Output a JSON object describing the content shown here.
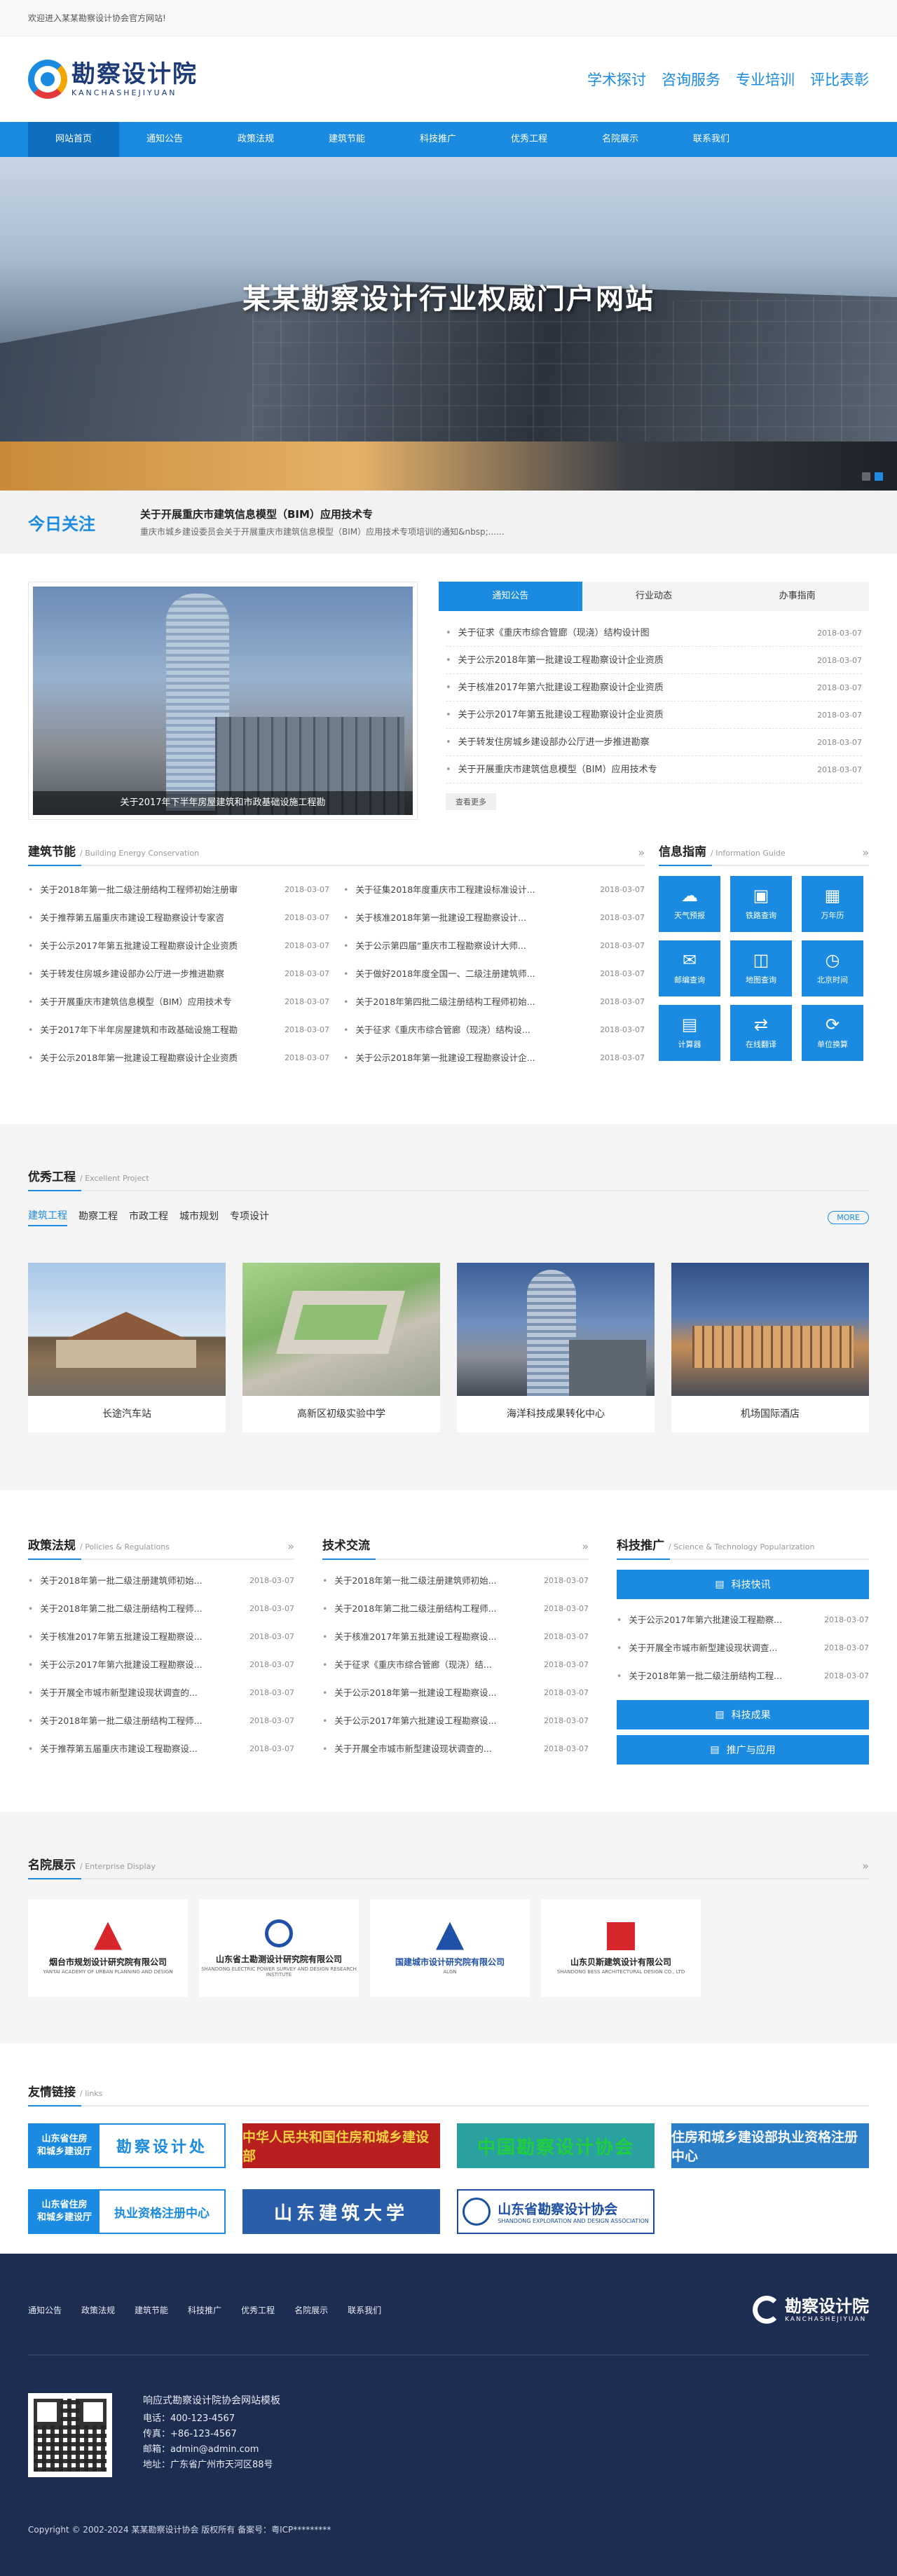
{
  "topbar": {
    "welcome": "欢迎进入某某勘察设计协会官方网站!"
  },
  "header": {
    "logo_cn": "勘察设计院",
    "logo_en": "KANCHASHEJIYUAN",
    "slogans": [
      "学术探讨",
      "咨询服务",
      "专业培训",
      "评比表彰"
    ]
  },
  "nav": {
    "items": [
      "网站首页",
      "通知公告",
      "政策法规",
      "建筑节能",
      "科技推广",
      "优秀工程",
      "名院展示",
      "联系我们"
    ]
  },
  "banner": {
    "title": "某某勘察设计行业权威门户网站"
  },
  "focus": {
    "label": "今日关注",
    "title": "关于开展重庆市建筑信息模型（BIM）应用技术专",
    "desc": "重庆市城乡建设委员会关于开展重庆市建筑信息模型（BIM）应用技术专项培训的通知&nbsp;......"
  },
  "news": {
    "photo_caption": "关于2017年下半年房屋建筑和市政基础设施工程勘",
    "tabs": [
      "通知公告",
      "行业动态",
      "办事指南"
    ],
    "items": [
      {
        "title": "关于征求《重庆市综合管廊（现浇）结构设计图",
        "date": "2018-03-07"
      },
      {
        "title": "关于公示2018年第一批建设工程勘察设计企业资质",
        "date": "2018-03-07"
      },
      {
        "title": "关于核准2017年第六批建设工程勘察设计企业资质",
        "date": "2018-03-07"
      },
      {
        "title": "关于公示2017年第五批建设工程勘察设计企业资质",
        "date": "2018-03-07"
      },
      {
        "title": "关于转发住房城乡建设部办公厅进一步推进勘察",
        "date": "2018-03-07"
      },
      {
        "title": "关于开展重庆市建筑信息模型（BIM）应用技术专",
        "date": "2018-03-07"
      }
    ],
    "more_label": "查看更多"
  },
  "energy": {
    "title": "建筑节能",
    "subtitle": "/ Building Energy Conservation",
    "left": [
      {
        "title": "关于2018年第一批二级注册结构工程师初始注册审",
        "date": "2018-03-07"
      },
      {
        "title": "关于推荐第五届重庆市建设工程勘察设计专家咨",
        "date": "2018-03-07"
      },
      {
        "title": "关于公示2017年第五批建设工程勘察设计企业资质",
        "date": "2018-03-07"
      },
      {
        "title": "关于转发住房城乡建设部办公厅进一步推进勘察",
        "date": "2018-03-07"
      },
      {
        "title": "关于开展重庆市建筑信息模型（BIM）应用技术专",
        "date": "2018-03-07"
      },
      {
        "title": "关于2017年下半年房屋建筑和市政基础设施工程勘",
        "date": "2018-03-07"
      },
      {
        "title": "关于公示2018年第一批建设工程勘察设计企业资质",
        "date": "2018-03-07"
      }
    ],
    "right": [
      {
        "title": "关于征集2018年度重庆市工程建设标准设计...",
        "date": "2018-03-07"
      },
      {
        "title": "关于核准2018年第一批建设工程勘察设计...",
        "date": "2018-03-07"
      },
      {
        "title": "关于公示第四届“重庆市工程勘察设计大师...",
        "date": "2018-03-07"
      },
      {
        "title": "关于做好2018年度全国一、二级注册建筑师...",
        "date": "2018-03-07"
      },
      {
        "title": "关于2018年第四批二级注册结构工程师初始...",
        "date": "2018-03-07"
      },
      {
        "title": "关于征求《重庆市综合管廊（现浇）结构设...",
        "date": "2018-03-07"
      },
      {
        "title": "关于公示2018年第一批建设工程勘察设计企...",
        "date": "2018-03-07"
      }
    ]
  },
  "info": {
    "title": "信息指南",
    "subtitle": "/ Information Guide",
    "cells": [
      {
        "label": "天气预报",
        "icon": "☁"
      },
      {
        "label": "铁路查询",
        "icon": "▣"
      },
      {
        "label": "万年历",
        "icon": "▦"
      },
      {
        "label": "邮编查询",
        "icon": "✉"
      },
      {
        "label": "地图查询",
        "icon": "◫"
      },
      {
        "label": "北京时间",
        "icon": "◷"
      },
      {
        "label": "计算器",
        "icon": "▤"
      },
      {
        "label": "在线翻译",
        "icon": "⇄"
      },
      {
        "label": "单位换算",
        "icon": "⟳"
      }
    ]
  },
  "projects": {
    "title": "优秀工程",
    "subtitle": "/ Excellent Project",
    "tabs": [
      "建筑工程",
      "勘察工程",
      "市政工程",
      "城市规划",
      "专项设计"
    ],
    "more": "MORE",
    "items": [
      "长途汽车站",
      "高新区初级实验中学",
      "海洋科技成果转化中心",
      "机场国际酒店"
    ]
  },
  "policy": {
    "title": "政策法规",
    "subtitle": "/ Policies & Regulations",
    "items": [
      {
        "title": "关于2018年第一批二级注册建筑师初始...",
        "date": "2018-03-07"
      },
      {
        "title": "关于2018年第二批二级注册结构工程师...",
        "date": "2018-03-07"
      },
      {
        "title": "关于核准2017年第五批建设工程勘察设...",
        "date": "2018-03-07"
      },
      {
        "title": "关于公示2017年第六批建设工程勘察设...",
        "date": "2018-03-07"
      },
      {
        "title": "关于开展全市城市新型建设现状调查的...",
        "date": "2018-03-07"
      },
      {
        "title": "关于2018年第一批二级注册结构工程师...",
        "date": "2018-03-07"
      },
      {
        "title": "关于推荐第五届重庆市建设工程勘察设...",
        "date": "2018-03-07"
      }
    ]
  },
  "tech": {
    "title": "技术交流",
    "items": [
      {
        "title": "关于2018年第一批二级注册建筑师初始...",
        "date": "2018-03-07"
      },
      {
        "title": "关于2018年第二批二级注册结构工程师...",
        "date": "2018-03-07"
      },
      {
        "title": "关于核准2017年第五批建设工程勘察设...",
        "date": "2018-03-07"
      },
      {
        "title": "关于征求《重庆市综合管廊（现浇）结...",
        "date": "2018-03-07"
      },
      {
        "title": "关于公示2018年第一批建设工程勘察设...",
        "date": "2018-03-07"
      },
      {
        "title": "关于公示2017年第六批建设工程勘察设...",
        "date": "2018-03-07"
      },
      {
        "title": "关于开展全市城市新型建设现状调查的...",
        "date": "2018-03-07"
      }
    ]
  },
  "science": {
    "title": "科技推广",
    "subtitle": "/ Science & Technology Popularization",
    "bar1": "科技快讯",
    "items": [
      {
        "title": "关于公示2017年第六批建设工程勘察...",
        "date": "2018-03-07"
      },
      {
        "title": "关于开展全市城市新型建设现状调查...",
        "date": "2018-03-07"
      },
      {
        "title": "关于2018年第一批二级注册结构工程...",
        "date": "2018-03-07"
      }
    ],
    "bar2": "科技成果",
    "bar3": "推广与应用"
  },
  "enterprise": {
    "title": "名院展示",
    "subtitle": "/ Enterprise Display",
    "items": [
      {
        "name": "烟台市规划设计研究院有限公司",
        "sub": "YANTAI ACADEMY OF URBAN PLANNING AND DESIGN",
        "color": "#d8262d"
      },
      {
        "name": "山东省土勘测设计研究院有限公司",
        "sub": "SHANDONG ELECTRIC POWER SURVEY AND DESIGN RESEARCH INSTITUTE",
        "color": "#2051a8"
      },
      {
        "name": "国建城市设计研究院有限公司",
        "sub": "ALGN",
        "color": "#2051a8"
      },
      {
        "name": "山东贝斯建筑设计有限公司",
        "sub": "SHANDONG BESS ARCHITECTURAL DESIGN CO., LTD",
        "color": "#d8262d"
      }
    ]
  },
  "links": {
    "title": "友情链接",
    "subtitle": "/ links",
    "l1_left": "山东省住房\n和城乡建设厅",
    "l1_right": "勘察设计处",
    "l2": "中华人民共和国住房和城乡建设部",
    "l3": "中国勘察设计协会",
    "l4": "住房和城乡建设部执业资格注册中心",
    "l5_left": "山东省住房\n和城乡建设厅",
    "l5_right": "执业资格注册中心",
    "l6": "山东建筑大学",
    "l7_main": "山东省勘察设计协会",
    "l7_sub": "SHANDONG EXPLORATION AND DESIGN ASSOCIATION"
  },
  "footer": {
    "nav": [
      "通知公告",
      "政策法规",
      "建筑节能",
      "科技推广",
      "优秀工程",
      "名院展示",
      "联系我们"
    ],
    "logo_cn": "勘察设计院",
    "logo_en": "KANCHASHEJIYUAN",
    "site_title": "响应式勘察设计院协会网站模板",
    "phone": "电话：400-123-4567",
    "fax": "传真：+86-123-4567",
    "email": "邮箱：admin@admin.com",
    "address": "地址：广东省广州市天河区88号",
    "copyright": "Copyright © 2002-2024 某某勘察设计协会 版权所有 备案号：粤ICP*********"
  }
}
